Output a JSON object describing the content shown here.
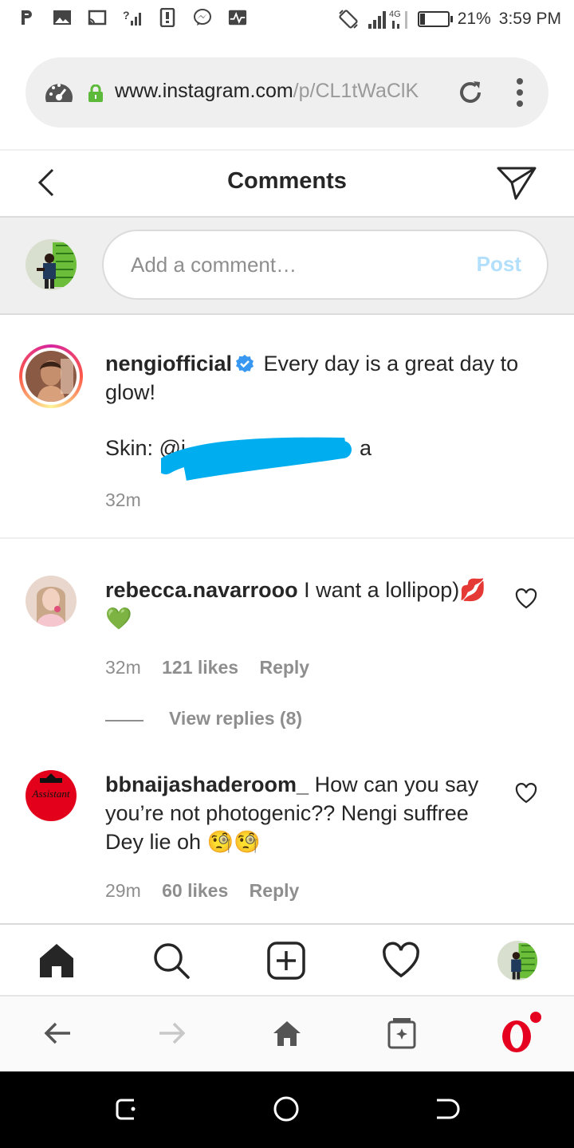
{
  "status_bar": {
    "network": "4G",
    "battery_percent": "21%",
    "time": "3:59 PM",
    "icons": [
      "pinterest-icon",
      "gallery-icon",
      "cast-icon",
      "no-signal-icon",
      "sim-icon",
      "messenger-icon",
      "activity-icon",
      "rotation-icon",
      "signal-icon",
      "battery-icon"
    ]
  },
  "browser": {
    "url_host": "www.instagram.com",
    "url_path": "/p/CL1tWaClK",
    "icons": [
      "speed-dial-icon",
      "lock-icon",
      "reload-icon",
      "more-icon"
    ]
  },
  "header": {
    "title": "Comments"
  },
  "compose": {
    "placeholder": "Add a comment…",
    "post_label": "Post"
  },
  "caption": {
    "username": "nengiofficial",
    "text": "Every day is a great day to glow!",
    "skin_prefix": "Skin: @i",
    "skin_suffix": "a",
    "time": "32m"
  },
  "comments": [
    {
      "username": "rebecca.navarrooo",
      "text": "I want a lollipop)💋 💚",
      "time": "32m",
      "likes": "121 likes",
      "reply_label": "Reply",
      "view_replies": "View replies (8)"
    },
    {
      "username": "bbnaijashaderoom_",
      "text": "How can you say you’re not photogenic?? Nengi suffree Dey lie oh 🧐🧐",
      "time": "29m",
      "likes": "60 likes",
      "reply_label": "Reply",
      "avatar_text": "Assistant"
    }
  ],
  "tabbar": {
    "icons": [
      "home-icon",
      "search-icon",
      "new-post-icon",
      "activity-heart-icon",
      "profile-avatar"
    ]
  },
  "opera_bar": {
    "icons": [
      "back-arrow-icon",
      "forward-arrow-icon",
      "home-icon",
      "tabs-icon",
      "opera-logo-icon"
    ]
  },
  "colors": {
    "accent_blue": "#0095f6",
    "post_disabled": "#b2dffc",
    "scribble": "#00aeef",
    "opera_red": "#e6001f"
  }
}
